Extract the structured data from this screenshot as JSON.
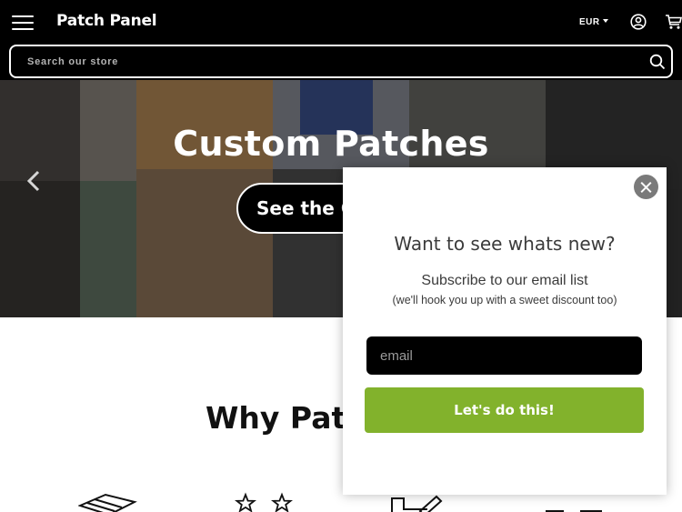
{
  "header": {
    "brand": "Patch Panel",
    "currency": "EUR",
    "menu_icon": "hamburger-icon",
    "account_icon": "user-circle-icon",
    "cart_icon": "cart-icon"
  },
  "search": {
    "placeholder": "Search our store",
    "icon": "search-icon"
  },
  "hero": {
    "title": "Custom Patches",
    "button_label": "See the C",
    "prev_icon": "chevron-left-icon"
  },
  "why": {
    "title": "Why Patc"
  },
  "popup": {
    "title": "Want to see whats new?",
    "subtitle": "Subscribe to our email list",
    "note": "(we'll hook you up with a sweet discount too)",
    "email_placeholder": "email",
    "submit_label": "Let's do this!",
    "close_icon": "close-icon"
  },
  "colors": {
    "header_bg": "#000000",
    "submit_green": "#82b22c",
    "close_grey": "#7a7a7a"
  }
}
